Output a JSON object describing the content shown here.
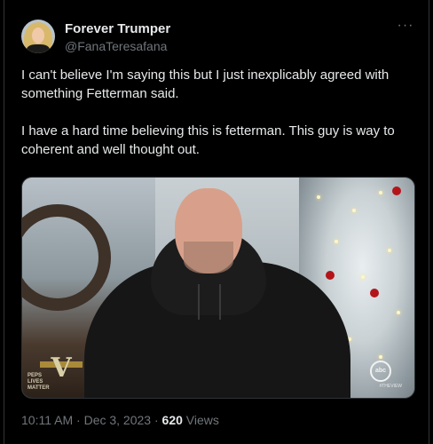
{
  "tweet": {
    "author": {
      "display_name": "Forever Trumper",
      "handle": "@FanaTeresafana"
    },
    "more_icon": "more-horizontal-icon",
    "paragraphs": [
      "I can't believe I'm saying this but I just inexplicably agreed with something Fetterman said.",
      "I have a hard time believing this is fetterman. This guy is way to coherent and well thought out."
    ],
    "media": {
      "overlay_left_logo": "V",
      "overlay_left_text": [
        "PEPS",
        "LIVES",
        "MATTER"
      ],
      "overlay_right_logo": "abc",
      "overlay_right_text": "#THEVIEW"
    },
    "meta": {
      "time": "10:11 AM",
      "sep1": "·",
      "date": "Dec 3, 2023",
      "sep2": "·",
      "views_count": "620",
      "views_label": "Views"
    }
  }
}
